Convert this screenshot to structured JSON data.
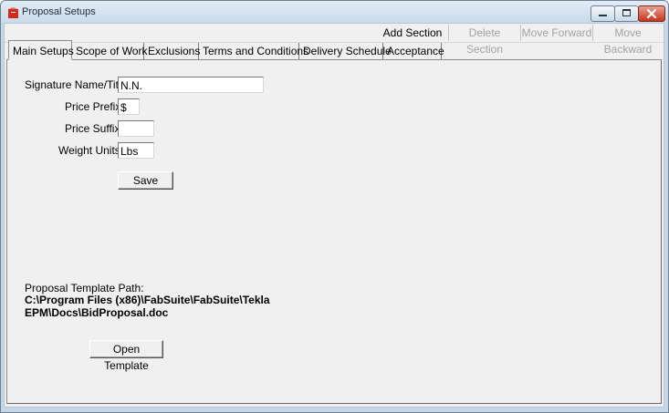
{
  "window": {
    "title": "Proposal Setups",
    "icon": "red-document-icon",
    "controls": [
      "minimize-icon",
      "maximize-icon",
      "close-icon"
    ]
  },
  "toolbar": {
    "add_section": "Add Section",
    "delete_section": "Delete Section",
    "move_forward": "Move Forward",
    "move_backward": "Move Backward"
  },
  "tabs": [
    {
      "label": "Main Setups",
      "active": true
    },
    {
      "label": "Scope of Work",
      "active": false
    },
    {
      "label": "Exclusions",
      "active": false
    },
    {
      "label": "Terms and Conditions",
      "active": false
    },
    {
      "label": "Delivery Schedule",
      "active": false
    },
    {
      "label": "Acceptance",
      "active": false
    }
  ],
  "form": {
    "signature_label": "Signature Name/Title:",
    "signature_value": "N.N.",
    "price_prefix_label": "Price Prefix:",
    "price_prefix_value": "$",
    "price_suffix_label": "Price Suffix:",
    "price_suffix_value": "",
    "weight_units_label": "Weight Units:",
    "weight_units_value": "Lbs",
    "save_label": "Save"
  },
  "template": {
    "path_label": "Proposal Template Path:",
    "path_line1": "C:\\Program Files (x86)\\FabSuite\\FabSuite\\Tekla",
    "path_line2": "EPM\\Docs\\BidProposal.doc",
    "open_label": "Open Template"
  },
  "colors": {
    "title_bar": "#cbdaea",
    "close_button": "#c7361d",
    "client_background": "#f0f0f0",
    "disabled_text": "#a3a3a3"
  }
}
